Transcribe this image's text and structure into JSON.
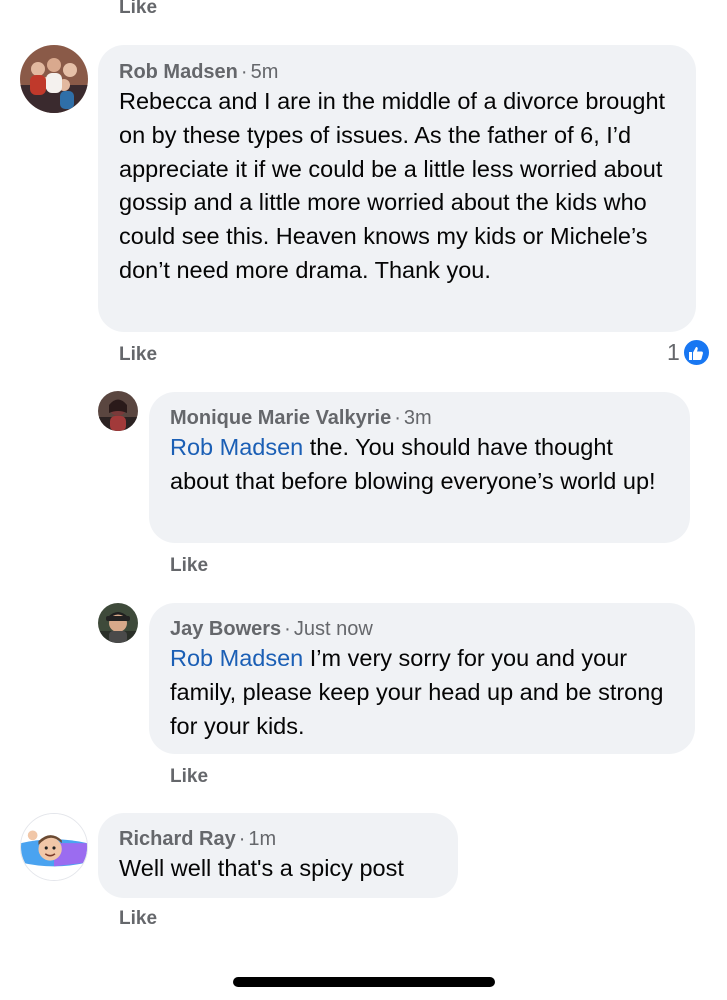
{
  "top_like": "Like",
  "comments": [
    {
      "author": "Rob Madsen",
      "time": "5m",
      "text": "Rebecca and I are in the middle of a divorce brought on by these types of issues. As the father of 6, I’d appreciate it if we could be a little less worried about gossip and a little more worried about the kids who could see this. Heaven knows my kids or Michele’s don’t need more drama. Thank you.",
      "like_label": "Like",
      "reaction_count": "1",
      "reaction_icon": "thumbs-up-icon",
      "reaction_color": "#1877f2"
    },
    {
      "author": "Monique Marie Valkyrie",
      "time": "3m",
      "mention": "Rob Madsen",
      "text": " the. You should have thought about that before blowing everyone’s world up!",
      "like_label": "Like"
    },
    {
      "author": "Jay Bowers",
      "time": "Just now",
      "mention": "Rob Madsen",
      "text": " I’m very sorry for you and your family, please keep your head up and be strong for your kids.",
      "like_label": "Like"
    },
    {
      "author": "Richard Ray",
      "time": "1m",
      "text": "Well well that's a spicy post",
      "like_label": "Like"
    }
  ],
  "colors": {
    "bubble_bg": "#f0f2f5",
    "meta_gray": "#65676b",
    "mention_blue": "#1b5fb5",
    "like_blue": "#1877f2"
  }
}
